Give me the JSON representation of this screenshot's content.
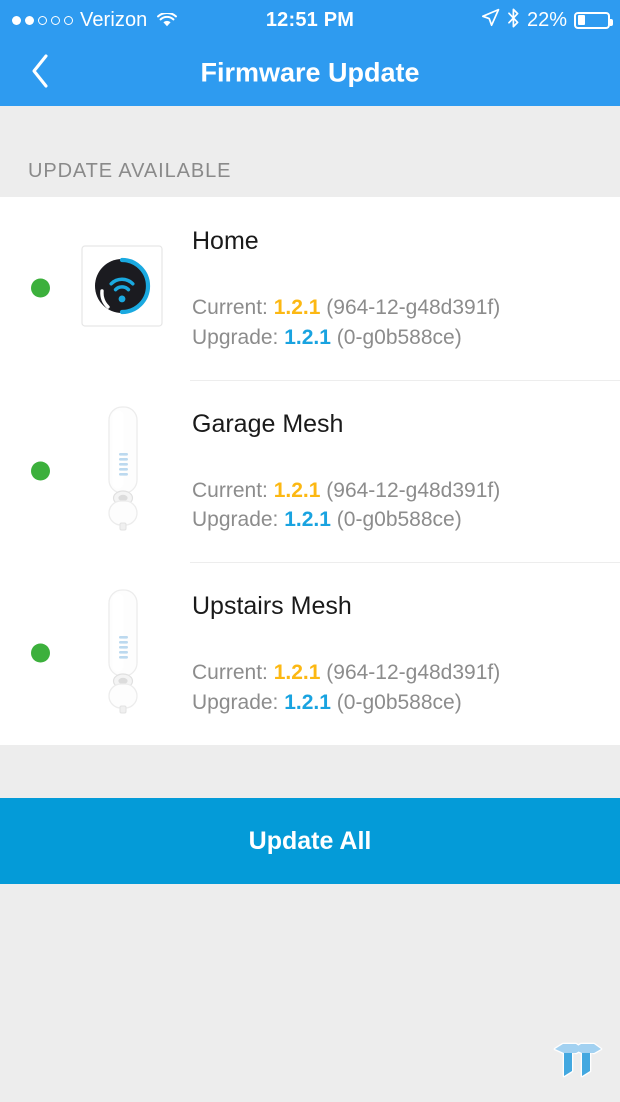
{
  "statusbar": {
    "signal_filled": 2,
    "signal_total": 5,
    "carrier": "Verizon",
    "wifi_icon": "wifi-icon",
    "time": "12:51 PM",
    "location_icon": "location-arrow-icon",
    "bluetooth_icon": "bluetooth-icon",
    "battery_text": "22%",
    "battery_percent": 22
  },
  "navbar": {
    "back_icon": "chevron-left-icon",
    "title": "Firmware Update"
  },
  "section": {
    "header": "UPDATE AVAILABLE"
  },
  "devices": [
    {
      "name": "Home",
      "status": "online",
      "icon": "router-device-icon",
      "current_label": "Current:",
      "current_version": "1.2.1",
      "current_build": "(964-12-g48d391f)",
      "upgrade_label": "Upgrade:",
      "upgrade_version": "1.2.1",
      "upgrade_build": "(0-g0b588ce)"
    },
    {
      "name": "Garage Mesh",
      "status": "online",
      "icon": "mesh-extender-icon",
      "current_label": "Current:",
      "current_version": "1.2.1",
      "current_build": "(964-12-g48d391f)",
      "upgrade_label": "Upgrade:",
      "upgrade_version": "1.2.1",
      "upgrade_build": "(0-g0b588ce)"
    },
    {
      "name": "Upstairs Mesh",
      "status": "online",
      "icon": "mesh-extender-icon",
      "current_label": "Current:",
      "current_version": "1.2.1",
      "current_build": "(964-12-g48d391f)",
      "upgrade_label": "Upgrade:",
      "upgrade_version": "1.2.1",
      "upgrade_build": "(0-g0b588ce)"
    }
  ],
  "footer": {
    "update_all_label": "Update All"
  },
  "watermark": {
    "icon": "tt-logo-watermark"
  },
  "colors": {
    "navbar_blue": "#2e9bf0",
    "button_blue": "#049bd8",
    "status_green": "#3cb03c",
    "current_amber": "#fcb813",
    "upgrade_blue": "#19a3e0",
    "page_gray": "#ededed"
  }
}
